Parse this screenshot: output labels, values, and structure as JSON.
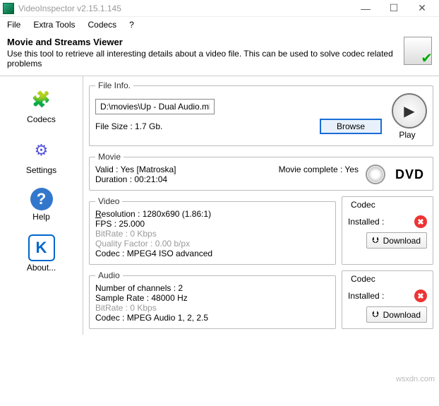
{
  "titlebar": {
    "title": "VideoInspector v2.15.1.145"
  },
  "menu": {
    "file": "File",
    "extra": "Extra Tools",
    "codecs": "Codecs",
    "help": "?"
  },
  "header": {
    "title": "Movie and Streams Viewer",
    "sub": "Use this tool to retrieve all interesting details about a video file. This can be used to solve codec related problems"
  },
  "sidebar": {
    "codecs": "Codecs",
    "settings": "Settings",
    "help": "Help",
    "about": "About..."
  },
  "fileinfo": {
    "legend": "File Info.",
    "path": "D:\\movies\\Up - Dual Audio.mkv",
    "size_label": "File Size : 1.7 Gb.",
    "browse": "Browse",
    "play": "Play"
  },
  "movie": {
    "legend": "Movie",
    "valid": "Valid : Yes [Matroska]",
    "duration": "Duration : 00:21:04",
    "complete": "Movie complete : Yes",
    "dvd": "DVD"
  },
  "video": {
    "legend": "Video",
    "res_prefix": "R",
    "res_rest": "esolution : 1280x690 (1.86:1)",
    "fps": "FPS : 25.000",
    "bitrate": "BitRate : 0 Kbps",
    "quality": "Quality Factor : 0.00 b/px",
    "codec": "Codec : MPEG4 ISO advanced"
  },
  "audio": {
    "legend": "Audio",
    "channels": "Number of channels : 2",
    "sample": "Sample Rate : 48000 Hz",
    "bitrate": "BitRate : 0 Kbps",
    "codec": "Codec : MPEG Audio 1, 2, 2.5"
  },
  "codecbox": {
    "legend": "Codec",
    "installed": "Installed :",
    "download": "Download"
  },
  "watermark": "wsxdn.com"
}
